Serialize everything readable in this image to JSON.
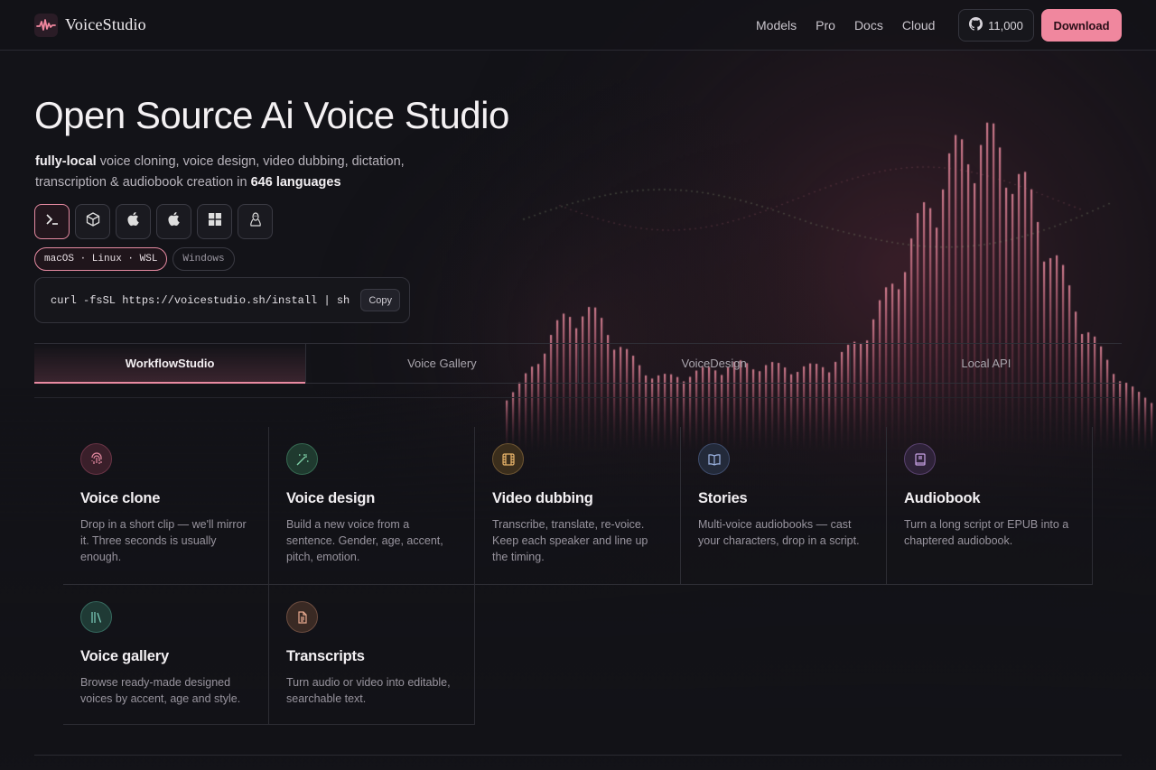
{
  "nav": {
    "brand": "VoiceStudio",
    "links": [
      "Models",
      "Pro",
      "Docs",
      "Cloud"
    ],
    "github_stars": "11,000",
    "download_label": "Download"
  },
  "hero": {
    "title": "Open Source Ai Voice Studio",
    "sub_bold_1": "fully-local",
    "sub_text_1": " voice cloning, voice design, video dubbing, dictation, transcription & audiobook creation in ",
    "sub_bold_2": "646 languages"
  },
  "install": {
    "os_buttons": [
      "terminal-icon",
      "package-icon",
      "apple-icon",
      "apple-icon",
      "windows-icon",
      "linux-icon"
    ],
    "platform_pills": [
      "macOS · Linux · WSL",
      "Windows"
    ],
    "command": "curl -fsSL https://voicestudio.sh/install | sh",
    "copy_label": "Copy"
  },
  "tabs": [
    "WorkflowStudio",
    "Voice Gallery",
    "VoiceDesign",
    "Local API"
  ],
  "features": [
    {
      "title": "Voice clone",
      "desc": "Drop in a short clip — we'll mirror it. Three seconds is usually enough.",
      "icon": "fingerprint-icon",
      "color": "#e58aa1"
    },
    {
      "title": "Voice design",
      "desc": "Build a new voice from a sentence. Gender, age, accent, pitch, emotion.",
      "icon": "wand-icon",
      "color": "#7fd1a8"
    },
    {
      "title": "Video dubbing",
      "desc": "Transcribe, translate, re-voice. Keep each speaker and line up the timing.",
      "icon": "film-icon",
      "color": "#e8b46a"
    },
    {
      "title": "Stories",
      "desc": "Multi-voice audiobooks — cast your characters, drop in a script.",
      "icon": "book-open-icon",
      "color": "#9fb7e6"
    },
    {
      "title": "Audiobook",
      "desc": "Turn a long script or EPUB into a chaptered audiobook.",
      "icon": "book-icon",
      "color": "#c9a3e6"
    },
    {
      "title": "Voice gallery",
      "desc": "Browse ready-made designed voices by accent, age and style.",
      "icon": "library-icon",
      "color": "#7fd1bf"
    },
    {
      "title": "Transcripts",
      "desc": "Turn audio or video into editable, searchable text.",
      "icon": "document-icon",
      "color": "#e8a98f"
    }
  ]
}
